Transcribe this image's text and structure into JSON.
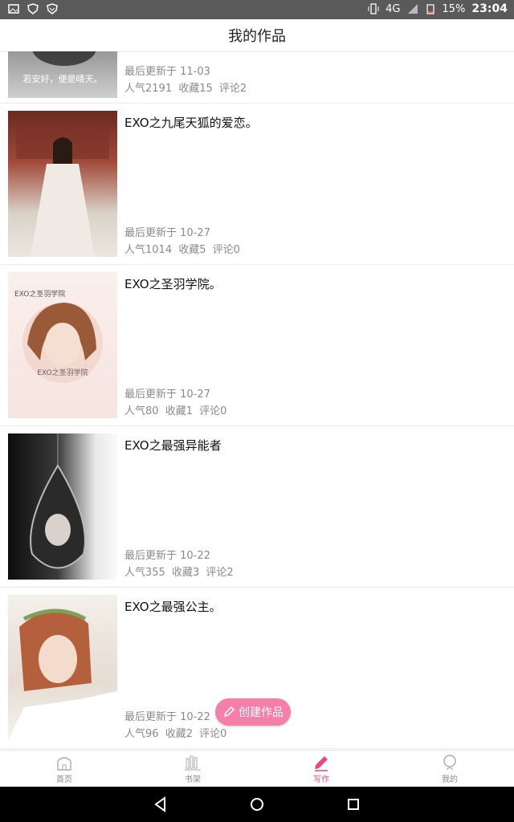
{
  "status_bar": {
    "network": "4G",
    "battery": "15%",
    "time": "23:04"
  },
  "header": {
    "title": "我的作品"
  },
  "works": [
    {
      "title": "",
      "updated": "最后更新于 11-03",
      "popularity": "人气2191",
      "favorites": "收藏15",
      "comments": "评论2",
      "cover_caption": "若安好，便是晴天。"
    },
    {
      "title": "EXO之九尾天狐的爱恋。",
      "updated": "最后更新于 10-27",
      "popularity": "人气1014",
      "favorites": "收藏5",
      "comments": "评论0"
    },
    {
      "title": "EXO之圣羽学院。",
      "updated": "最后更新于 10-27",
      "popularity": "人气80",
      "favorites": "收藏1",
      "comments": "评论0",
      "cover_caption_top": "EXO之圣羽学院",
      "cover_caption_bottom": "EXO之圣羽学院"
    },
    {
      "title": "EXO之最强异能者",
      "updated": "最后更新于 10-22",
      "popularity": "人气355",
      "favorites": "收藏3",
      "comments": "评论2"
    },
    {
      "title": "EXO之最强公主。",
      "updated": "最后更新于 10-22",
      "popularity": "人气96",
      "favorites": "收藏2",
      "comments": "评论0"
    }
  ],
  "fab": {
    "label": "创建作品",
    "color": "#f47fa8"
  },
  "tabs": [
    {
      "label": "首页",
      "icon": "home-icon"
    },
    {
      "label": "书架",
      "icon": "bookshelf-icon"
    },
    {
      "label": "写作",
      "icon": "pencil-icon",
      "active": true
    },
    {
      "label": "我的",
      "icon": "profile-icon"
    }
  ],
  "accent_color": "#e8487d"
}
